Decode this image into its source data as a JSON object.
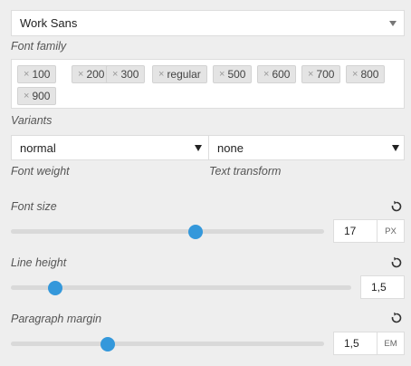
{
  "font_family": {
    "value": "Work Sans",
    "label": "Font family"
  },
  "variants": {
    "label": "Variants",
    "remove_glyph": "×",
    "chips": [
      "100",
      "200",
      "300",
      "regular",
      "500",
      "600",
      "700",
      "800",
      "900"
    ]
  },
  "font_weight": {
    "value": "normal",
    "label": "Font weight"
  },
  "text_transform": {
    "value": "none",
    "label": "Text transform"
  },
  "font_size": {
    "label": "Font size",
    "value": "17",
    "unit": "PX",
    "level": 0.59
  },
  "line_height": {
    "label": "Line height",
    "value": "1,5",
    "level": 0.13
  },
  "paragraph_margin": {
    "label": "Paragraph margin",
    "value": "1,5",
    "unit": "EM",
    "level": 0.31
  },
  "colors": {
    "accent": "#3498db",
    "track": "#d9d9d9"
  },
  "icons": {
    "dropdown": "triangle-down-icon",
    "reset": "reset-icon"
  }
}
